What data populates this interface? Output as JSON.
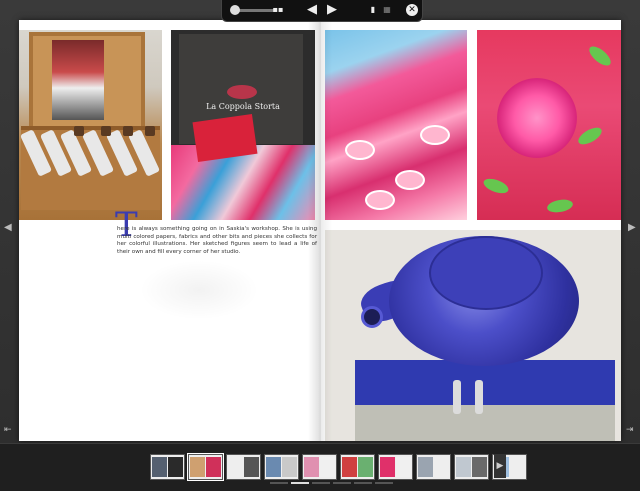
{
  "article": {
    "drop_cap": "T",
    "body": "here is always something going on in Saskia's workshop. She is using multi colored papers, fabrics and other bits and pieces she collects for her colorful illustrations. Her sketched figures seem to lead a life of their own and fill every corner of her studio."
  },
  "photos": {
    "book_label": "La Coppola Storta"
  },
  "toolbar": {
    "zoom_icon": "zoom-slider-icon",
    "prev_icon": "triangle-left-icon",
    "next_icon": "triangle-right-icon",
    "prev_glyph": "◀",
    "next_glyph": "▶",
    "close_glyph": "✕"
  },
  "navigation": {
    "left_arrow": "◀",
    "right_arrow": "▶",
    "first_glyph": "⇤",
    "last_glyph": "⇥",
    "thumb_next_glyph": "▶"
  },
  "thumbnails": [
    {
      "a": "#556070",
      "b": "#2a2a2a"
    },
    {
      "a": "#cfa070",
      "b": "#d0305a",
      "selected": true
    },
    {
      "a": "#eeeeee",
      "b": "#555555"
    },
    {
      "a": "#6a8ab0",
      "b": "#c9c9c9"
    },
    {
      "a": "#e090b0",
      "b": "#f0f0f0"
    },
    {
      "a": "#d04040",
      "b": "#6ab070"
    },
    {
      "a": "#e0306a",
      "b": "#f0f0f0"
    },
    {
      "a": "#9aa4b0",
      "b": "#eeeeee"
    },
    {
      "a": "#c0c8d0",
      "b": "#6a6a6a"
    },
    {
      "a": "#a0c0e0",
      "b": "#eeeeee"
    }
  ],
  "page_dots": [
    false,
    true,
    false,
    false,
    false,
    false
  ]
}
